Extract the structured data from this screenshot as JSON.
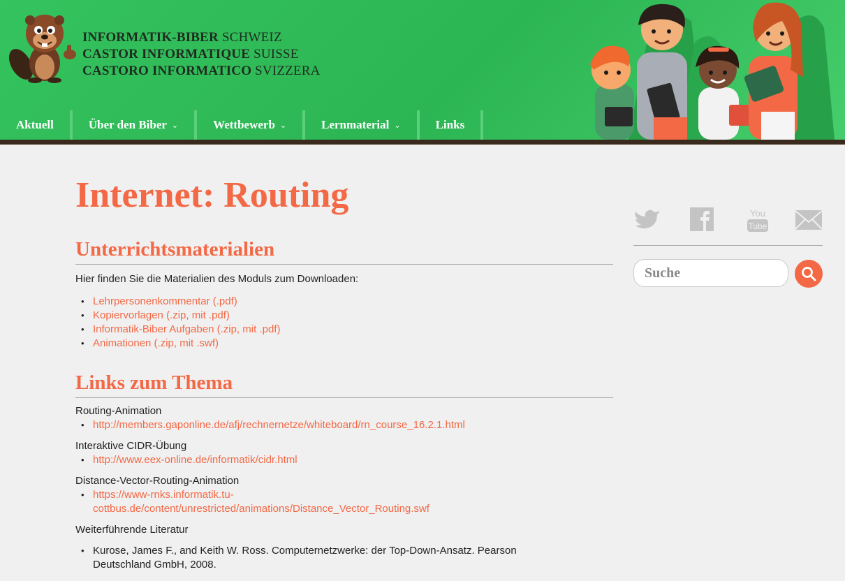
{
  "header": {
    "brand_lines": [
      {
        "bold": "INFORMATIK-BIBER",
        "light": "SCHWEIZ"
      },
      {
        "bold": "CASTOR INFORMATIQUE",
        "light": "SUISSE"
      },
      {
        "bold": "CASTORO INFORMATICO",
        "light": "SVIZZERA"
      }
    ],
    "nav": [
      {
        "label": "Aktuell",
        "dropdown": false
      },
      {
        "label": "Über den Biber",
        "dropdown": true
      },
      {
        "label": "Wettbewerb",
        "dropdown": true
      },
      {
        "label": "Lernmaterial",
        "dropdown": true
      },
      {
        "label": "Links",
        "dropdown": false
      }
    ]
  },
  "main": {
    "title": "Internet: Routing",
    "materials": {
      "heading": "Unterrichtsmaterialien",
      "intro": "Hier finden Sie die Materialien des Moduls zum Downloaden:",
      "items": [
        "Lehrpersonenkommentar (.pdf)",
        "Kopiervorlagen (.zip, mit .pdf)",
        "Informatik-Biber Aufgaben (.zip, mit .pdf)",
        "Animationen (.zip, mit .swf)"
      ]
    },
    "topic_links": {
      "heading": "Links zum Thema",
      "groups": [
        {
          "title": "Routing-Animation",
          "link": "http://members.gaponline.de/afj/rechnernetze/whiteboard/rn_course_16.2.1.html"
        },
        {
          "title": "Interaktive CIDR-Übung",
          "link": "http://www.eex-online.de/informatik/cidr.html"
        },
        {
          "title": "Distance-Vector-Routing-Animation",
          "link_line1": "https://www-rnks.informatik.tu-",
          "link_line2": "cottbus.de/content/unrestricted/animations/Distance_Vector_Routing.swf"
        }
      ],
      "literature": {
        "title": "Weiterführende Literatur",
        "item_line1": "Kurose, James F., and Keith W. Ross. Computernetzwerke: der Top-Down-Ansatz. Pearson",
        "item_line2": "Deutschland GmbH, 2008."
      }
    }
  },
  "sidebar": {
    "social_icons": [
      "twitter-icon",
      "facebook-icon",
      "youtube-icon",
      "mail-icon"
    ],
    "youtube_text_top": "You",
    "youtube_text_bottom": "Tube",
    "search_placeholder": "Suche"
  },
  "colors": {
    "accent": "#f36845",
    "header_green": "#34c35e",
    "header_border": "#3a2a1e",
    "icon_gray": "#c4c4c4"
  }
}
